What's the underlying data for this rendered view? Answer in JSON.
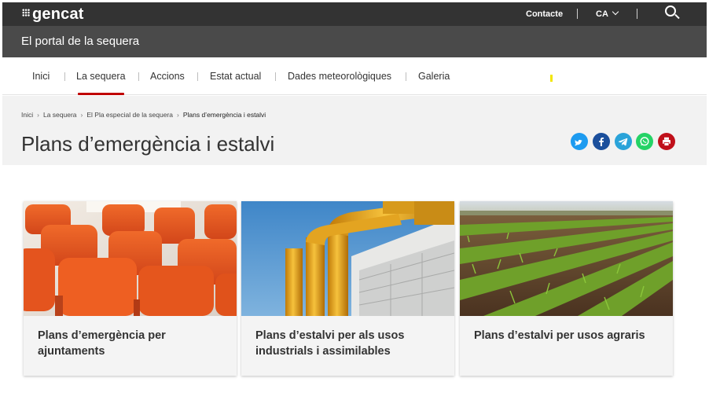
{
  "header": {
    "logo": "gencat",
    "contact": "Contacte",
    "language": "CA",
    "colors": {
      "topbar": "#333333",
      "portalbar": "#4a4a4a",
      "accent": "#c00000"
    }
  },
  "portal": {
    "title": "El portal de la sequera"
  },
  "nav": {
    "items": [
      "Inici",
      "La sequera",
      "Accions",
      "Estat actual",
      "Dades meteorològiques",
      "Galeria"
    ],
    "active_index": 1
  },
  "breadcrumb": [
    "Inici",
    "La sequera",
    "El Pla especial de la sequera",
    "Plans d’emergència i estalvi"
  ],
  "page": {
    "title": "Plans d’emergència i estalvi"
  },
  "share": [
    {
      "icon": "twitter-icon",
      "color": "#1d9bf0"
    },
    {
      "icon": "facebook-icon",
      "color": "#1b4f9c"
    },
    {
      "icon": "telegram-icon",
      "color": "#2aa3d9"
    },
    {
      "icon": "whatsapp-icon",
      "color": "#25d366"
    },
    {
      "icon": "print-icon",
      "color": "#c0101a"
    }
  ],
  "cards": [
    {
      "title": "Plans d’emergència per ajuntaments",
      "image": "orange-chairs-photo"
    },
    {
      "title": "Plans d’estalvi per als usos industrials i assimilables",
      "image": "industrial-pipes-photo"
    },
    {
      "title": "Plans d’estalvi per usos agraris",
      "image": "crop-field-photo"
    }
  ]
}
